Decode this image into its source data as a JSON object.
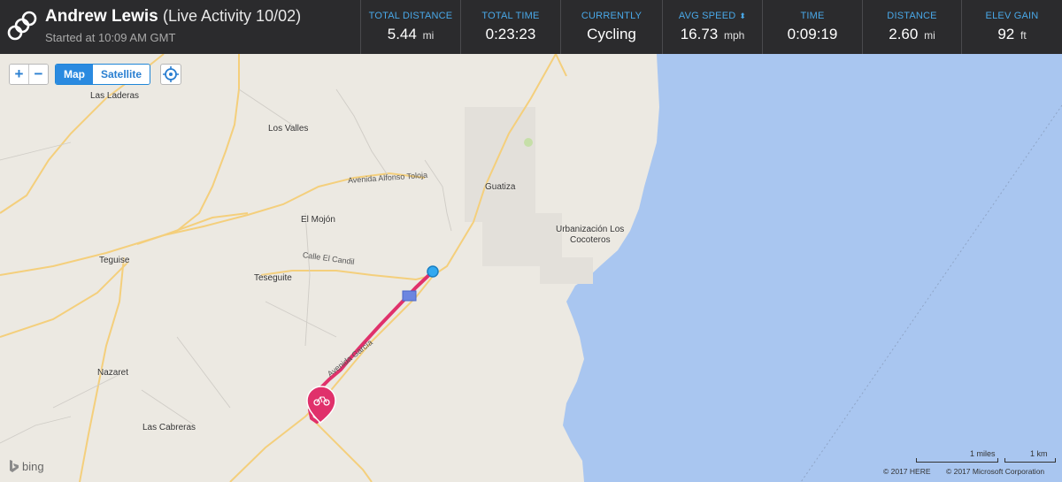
{
  "header": {
    "user_name": "Andrew Lewis",
    "activity_title": "(Live Activity 10/02)",
    "started": "Started at 10:09 AM GMT",
    "logo_icon": "linked-rings-logo-icon"
  },
  "stats": [
    {
      "label": "TOTAL DISTANCE",
      "value": "5.44",
      "unit": "mi"
    },
    {
      "label": "TOTAL TIME",
      "value": "0:23:23",
      "unit": ""
    },
    {
      "label": "CURRENTLY",
      "value": "Cycling",
      "unit": ""
    },
    {
      "label": "AVG SPEED",
      "value": "16.73",
      "unit": "mph",
      "sort_icon": "⬍"
    },
    {
      "label": "TIME",
      "value": "0:09:19",
      "unit": ""
    },
    {
      "label": "DISTANCE",
      "value": "2.60",
      "unit": "mi"
    },
    {
      "label": "ELEV GAIN",
      "value": "92",
      "unit": "ft"
    }
  ],
  "map_controls": {
    "zoom_in": "+",
    "zoom_out": "−",
    "map_label": "Map",
    "satellite_label": "Satellite",
    "selected": "Map"
  },
  "places": {
    "las_laderas": "Las Laderas",
    "los_valles": "Los Valles",
    "guatiza": "Guatiza",
    "urbanizacion_1": "Urbanización Los",
    "urbanizacion_2": "Cocoteros",
    "el_mojon": "El Mojón",
    "teguise": "Teguise",
    "teseguite": "Teseguite",
    "nazaret": "Nazaret",
    "las_cabreras": "Las Cabreras"
  },
  "roads": {
    "avenida_alfonso": "Avenida Alfonso Toloja",
    "calle_candil": "Calle El Candil",
    "avenida_garcia": "Avenida García"
  },
  "footer": {
    "bing": "bing",
    "scale_miles": "1 miles",
    "scale_km": "1 km",
    "copyright_here": "© 2017 HERE",
    "copyright_ms": "© 2017 Microsoft Corporation"
  },
  "colors": {
    "header_bg": "#2b2b2d",
    "label_blue": "#49a8e8",
    "route": "#e0316b",
    "sea": "#a9c6f0",
    "land": "#ece9e2",
    "road": "#f4cf7c"
  }
}
